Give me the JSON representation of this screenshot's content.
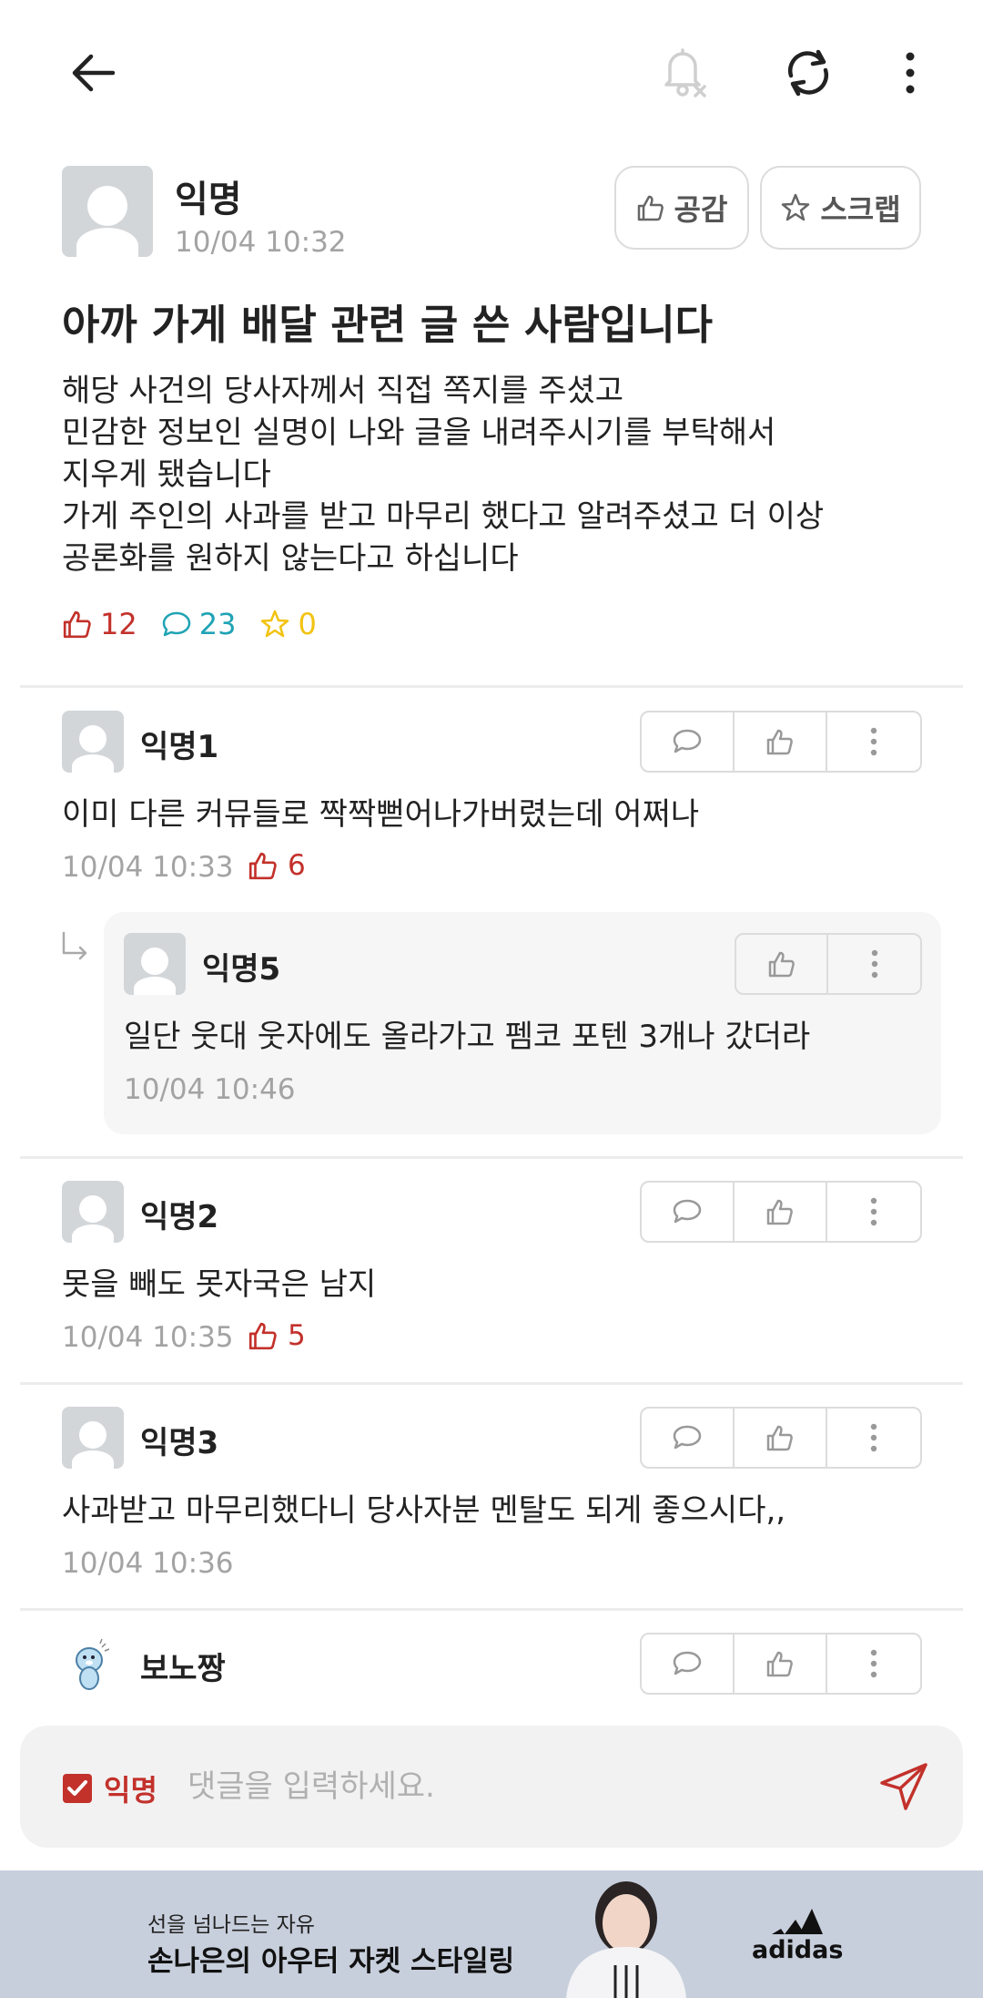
{
  "topbar": {
    "back_icon": "arrow-left-icon",
    "notify_icon": "bell-off-icon",
    "refresh_icon": "refresh-icon",
    "more_icon": "more-vertical-icon"
  },
  "post": {
    "author": "익명",
    "date": "10/04 10:32",
    "like_button": "공감",
    "scrap_button": "스크랩",
    "title": "아까 가게 배달 관련 글 쓴 사람입니다",
    "body": [
      "해당 사건의 당사자께서 직접 쪽지를 주셨고",
      "민감한 정보인 실명이 나와 글을 내려주시기를 부탁해서",
      "지우게 됐습니다",
      "가게 주인의 사과를 받고 마무리 했다고 알려주셨고 더 이상",
      "공론화를 원하지 않는다고 하십니다"
    ],
    "stats": {
      "likes": "12",
      "comments": "23",
      "scraps": "0"
    },
    "colors": {
      "like": "#c3312b",
      "comment": "#1fa3b5",
      "scrap": "#f2c311"
    }
  },
  "comments": [
    {
      "author": "익명1",
      "text": "이미 다른 커뮤들로 짝짝뻗어나가버렸는데 어쩌나",
      "date": "10/04 10:33",
      "likes": "6"
    },
    {
      "author": "익명5",
      "text": "일단 웃대 웃자에도 올라가고 펨코 포텐 3개나 갔더라",
      "date": "10/04 10:46",
      "is_reply": true
    },
    {
      "author": "익명2",
      "text": "못을 빼도 못자국은 남지",
      "date": "10/04 10:35",
      "likes": "5"
    },
    {
      "author": "익명3",
      "text": "사과받고 마무리했다니 당사자분 멘탈도 되게 좋으시다,,",
      "date": "10/04 10:36"
    },
    {
      "author": "보노짱"
    }
  ],
  "input": {
    "anon_label": "익명",
    "anon_checked": true,
    "placeholder": "댓글을 입력하세요.",
    "accent": "#c3312b"
  },
  "ad": {
    "subtitle": "선을 넘나드는 자유",
    "headline": "손나은의 아우터 자켓 스타일링",
    "brand": "adidas"
  }
}
